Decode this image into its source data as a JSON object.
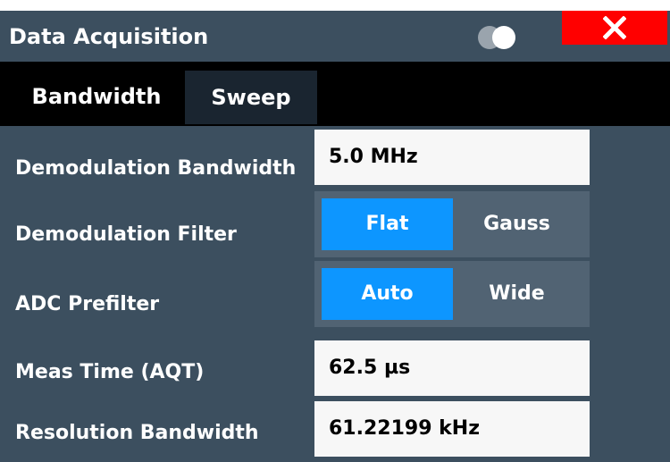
{
  "dialog": {
    "title": "Data Acquisition",
    "close_label": "✕"
  },
  "tabs": [
    {
      "label": "Bandwidth",
      "active": true
    },
    {
      "label": "Sweep",
      "active": false
    }
  ],
  "settings": {
    "demod_bandwidth": {
      "label": "Demodulation Bandwidth",
      "value": "5.0 MHz"
    },
    "demod_filter": {
      "label": "Demodulation Filter",
      "options": [
        "Flat",
        "Gauss"
      ],
      "selected": "Flat"
    },
    "adc_prefilter": {
      "label": "ADC Prefilter",
      "options": [
        "Auto",
        "Wide"
      ],
      "selected": "Auto"
    },
    "meas_time": {
      "label": "Meas Time (AQT)",
      "value": "62.5 µs"
    },
    "resolution_bandwidth": {
      "label": "Resolution Bandwidth",
      "value": "61.22199 kHz"
    }
  },
  "colors": {
    "titlebar": "#3c4f5f",
    "close": "#ff0000",
    "accent": "#0d96ff",
    "field": "#f7f7f7"
  }
}
